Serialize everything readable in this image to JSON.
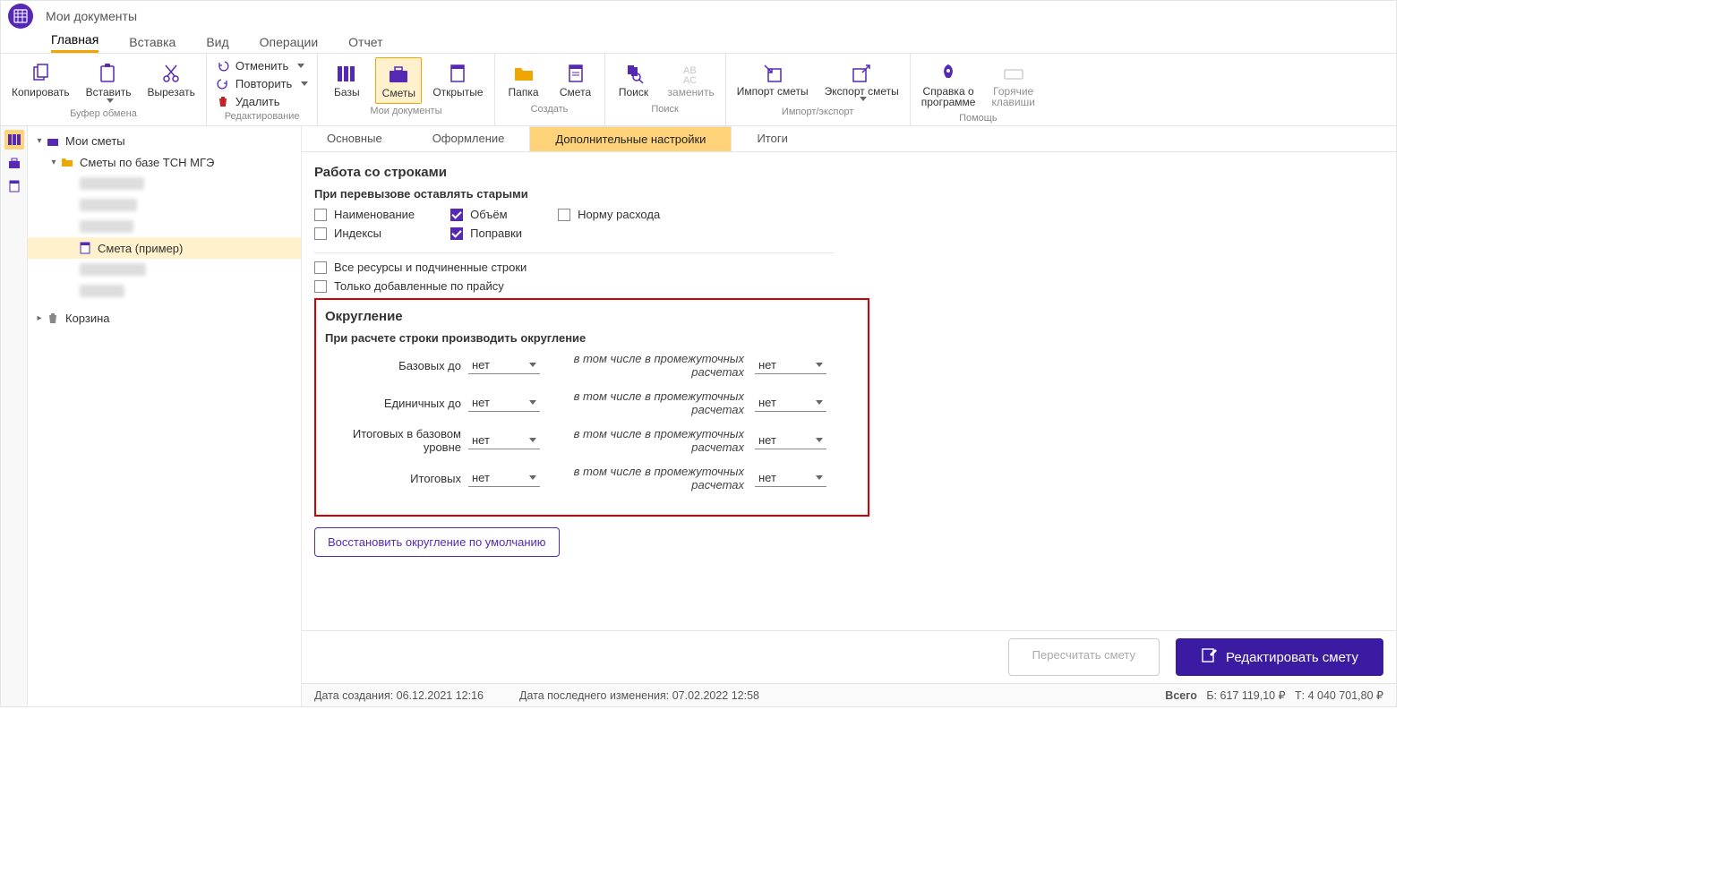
{
  "title": "Мои документы",
  "menu": {
    "items": [
      "Главная",
      "Вставка",
      "Вид",
      "Операции",
      "Отчет"
    ],
    "active": 0
  },
  "ribbon": {
    "clipboard": {
      "copy": "Копировать",
      "paste": "Вставить",
      "cut": "Вырезать",
      "label": "Буфер обмена"
    },
    "edit": {
      "undo": "Отменить",
      "redo": "Повторить",
      "delete": "Удалить",
      "label": "Редактирование"
    },
    "docs": {
      "bases": "Базы",
      "smety": "Сметы",
      "open": "Открытые",
      "label": "Мои документы"
    },
    "create": {
      "folder": "Папка",
      "smeta": "Смета",
      "label": "Создать"
    },
    "search": {
      "search": "Поиск",
      "replace": "заменить",
      "label": "Поиск"
    },
    "impexp": {
      "import": "Импорт сметы",
      "export": "Экспорт сметы",
      "label": "Импорт/экспорт"
    },
    "help": {
      "about1": "Справка о",
      "about2": "программе",
      "hotkeys1": "Горячие",
      "hotkeys2": "клавиши",
      "label": "Помощь"
    }
  },
  "tree": {
    "root": "Мои сметы",
    "folder": "Сметы по базе ТСН МГЭ",
    "selected": "Смета (пример)",
    "trash": "Корзина"
  },
  "tabs": {
    "items": [
      "Основные",
      "Оформление",
      "Дополнительные настройки",
      "Итоги"
    ],
    "active": 2
  },
  "form": {
    "s1_title": "Работа со строками",
    "s1_sub": "При перевызове оставлять старыми",
    "chk": {
      "name": "Наименование",
      "volume": "Объём",
      "norm": "Норму расхода",
      "indexes": "Индексы",
      "popravki": "Поправки",
      "all_res": "Все ресурсы и подчиненные строки",
      "only_added": "Только добавленные по прайсу"
    },
    "round_title": "Округление",
    "round_sub": "При расчете строки производить округление",
    "intermediate": "в том числе в промежуточных расчетах",
    "rows": [
      {
        "label": "Базовых до",
        "v1": "нет",
        "v2": "нет"
      },
      {
        "label": "Единичных до",
        "v1": "нет",
        "v2": "нет"
      },
      {
        "label": "Итоговых в базовом уровне",
        "v1": "нет",
        "v2": "нет"
      },
      {
        "label": "Итоговых",
        "v1": "нет",
        "v2": "нет"
      }
    ],
    "restore": "Восстановить округление по умолчанию"
  },
  "footer": {
    "recalc": "Пересчитать смету",
    "edit": "Редактировать смету"
  },
  "status": {
    "created_label": "Дата создания:",
    "created_val": "06.12.2021 12:16",
    "modified_label": "Дата последнего изменения:",
    "modified_val": "07.02.2022 12:58",
    "total_label": "Всего",
    "base_label": "Б:",
    "base_val": "617 119,10 ₽",
    "cur_label": "Т:",
    "cur_val": "4 040 701,80 ₽"
  }
}
